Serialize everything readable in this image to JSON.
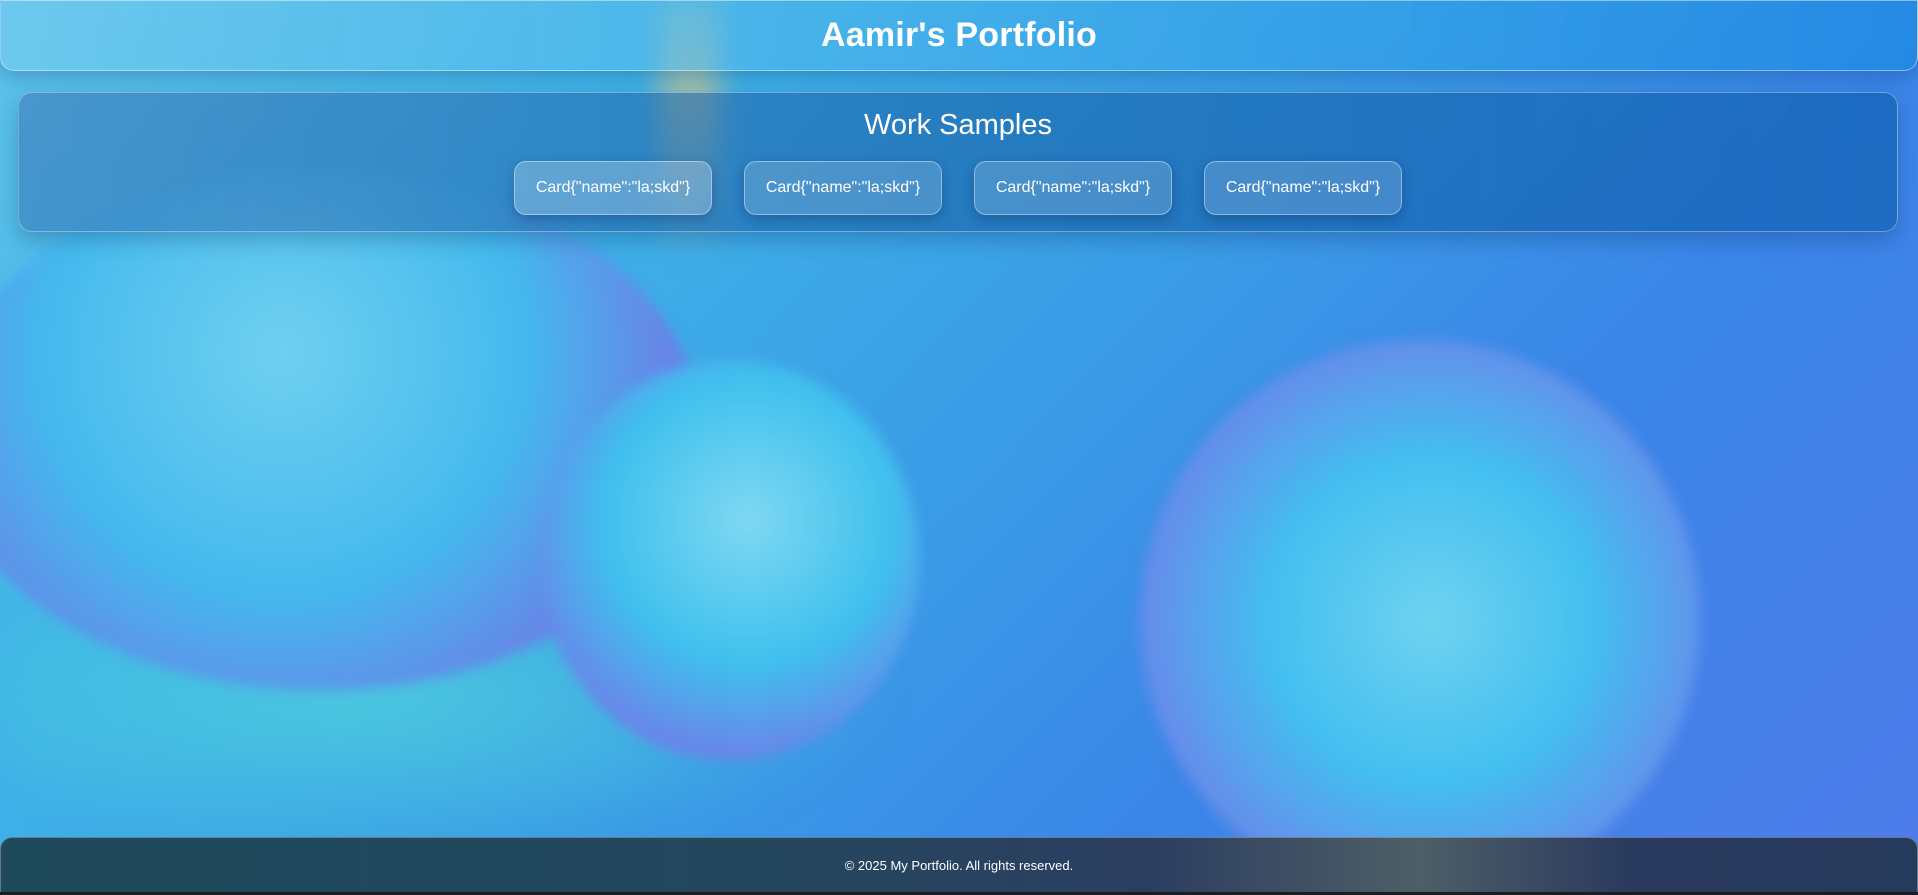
{
  "header": {
    "title": "Aamir's Portfolio"
  },
  "work_samples": {
    "title": "Work Samples",
    "cards": [
      {
        "label": "Card{\"name\":\"la;skd\"}"
      },
      {
        "label": "Card{\"name\":\"la;skd\"}"
      },
      {
        "label": "Card{\"name\":\"la;skd\"}"
      },
      {
        "label": "Card{\"name\":\"la;skd\"}"
      }
    ]
  },
  "footer": {
    "text": "© 2025 My Portfolio. All rights reserved."
  },
  "colors": {
    "text": "#ffffff",
    "background_accent": "#3fb4e8",
    "footer_background": "#24475e"
  }
}
